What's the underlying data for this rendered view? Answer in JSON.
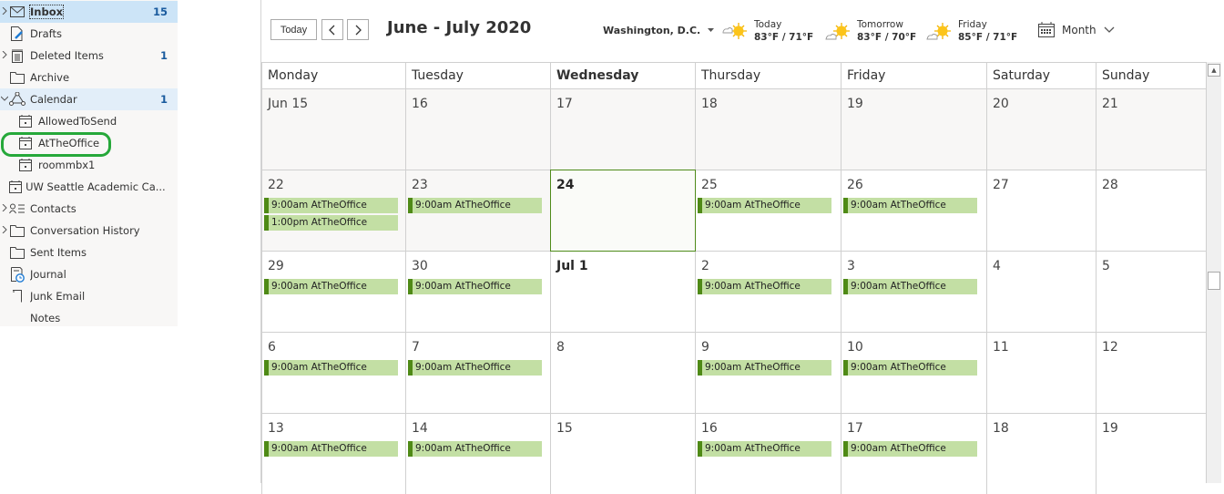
{
  "sidebar": {
    "folders": [
      {
        "label": "Inbox",
        "count": "15",
        "icon": "mail-icon",
        "expand": ">",
        "state": "selected"
      },
      {
        "label": "Drafts",
        "count": "",
        "icon": "drafts-icon",
        "expand": ""
      },
      {
        "label": "Deleted Items",
        "count": "1",
        "icon": "trash-icon",
        "expand": ">"
      },
      {
        "label": "Archive",
        "count": "",
        "icon": "folder-icon",
        "expand": ""
      },
      {
        "label": "Calendar",
        "count": "1",
        "icon": "calendar-group-icon",
        "expand": "v",
        "state": "highlight"
      },
      {
        "label": "AllowedToSend",
        "count": "",
        "icon": "calendar-icon",
        "sub": true
      },
      {
        "label": "AtTheOffice",
        "count": "",
        "icon": "calendar-icon",
        "sub": true,
        "circled": true
      },
      {
        "label": "roommbx1",
        "count": "",
        "icon": "calendar-icon",
        "sub": true
      },
      {
        "label": "UW Seattle Academic Ca...",
        "count": "",
        "icon": "calendar-icon",
        "sub": true
      },
      {
        "label": "Contacts",
        "count": "",
        "icon": "contacts-icon",
        "expand": ">"
      },
      {
        "label": "Conversation History",
        "count": "",
        "icon": "folder-icon",
        "expand": ">"
      },
      {
        "label": "Sent Items",
        "count": "",
        "icon": "folder-icon",
        "expand": ""
      },
      {
        "label": "Journal",
        "count": "",
        "icon": "journal-icon",
        "expand": ""
      },
      {
        "label": "Junk Email",
        "count": "",
        "icon": "junk-icon",
        "expand": ""
      },
      {
        "label": "Notes",
        "count": "",
        "icon": "",
        "expand": ""
      }
    ]
  },
  "toolbar": {
    "today_label": "Today",
    "prev_label": "<",
    "next_label": ">",
    "range_title": "June - July 2020",
    "location": "Washington, D.C.",
    "weather": [
      {
        "day": "Today",
        "temps": "83°F / 71°F"
      },
      {
        "day": "Tomorrow",
        "temps": "83°F / 70°F"
      },
      {
        "day": "Friday",
        "temps": "85°F / 71°F"
      }
    ],
    "view_label": "Month"
  },
  "calendar": {
    "colors": {
      "event_bg": "#c3dfa4",
      "event_bar": "#4f8a16",
      "today_border": "#4e8b1a"
    },
    "day_headers": [
      "Monday",
      "Tuesday",
      "Wednesday",
      "Thursday",
      "Friday",
      "Saturday",
      "Sunday"
    ],
    "current_weekday_index": 2,
    "weeks": [
      [
        {
          "label": "Jun 15",
          "past": true,
          "events": []
        },
        {
          "label": "16",
          "past": true,
          "events": []
        },
        {
          "label": "17",
          "past": true,
          "events": []
        },
        {
          "label": "18",
          "past": true,
          "events": []
        },
        {
          "label": "19",
          "past": true,
          "events": []
        },
        {
          "label": "20",
          "past": true,
          "events": []
        },
        {
          "label": "21",
          "past": true,
          "events": []
        }
      ],
      [
        {
          "label": "22",
          "past": true,
          "events": [
            "9:00am AtTheOffice",
            "1:00pm AtTheOffice"
          ]
        },
        {
          "label": "23",
          "past": true,
          "events": [
            "9:00am AtTheOffice"
          ]
        },
        {
          "label": "24",
          "today": true,
          "bold": true,
          "events": []
        },
        {
          "label": "25",
          "events": [
            "9:00am AtTheOffice"
          ]
        },
        {
          "label": "26",
          "events": [
            "9:00am AtTheOffice"
          ]
        },
        {
          "label": "27",
          "events": []
        },
        {
          "label": "28",
          "events": []
        }
      ],
      [
        {
          "label": "29",
          "events": [
            "9:00am AtTheOffice"
          ]
        },
        {
          "label": "30",
          "events": [
            "9:00am AtTheOffice"
          ]
        },
        {
          "label": "Jul 1",
          "bold": true,
          "events": []
        },
        {
          "label": "2",
          "events": [
            "9:00am AtTheOffice"
          ]
        },
        {
          "label": "3",
          "events": [
            "9:00am AtTheOffice"
          ]
        },
        {
          "label": "4",
          "events": []
        },
        {
          "label": "5",
          "events": []
        }
      ],
      [
        {
          "label": "6",
          "events": [
            "9:00am AtTheOffice"
          ]
        },
        {
          "label": "7",
          "events": [
            "9:00am AtTheOffice"
          ]
        },
        {
          "label": "8",
          "events": []
        },
        {
          "label": "9",
          "events": [
            "9:00am AtTheOffice"
          ]
        },
        {
          "label": "10",
          "events": [
            "9:00am AtTheOffice"
          ]
        },
        {
          "label": "11",
          "events": []
        },
        {
          "label": "12",
          "events": []
        }
      ],
      [
        {
          "label": "13",
          "events": [
            "9:00am AtTheOffice"
          ]
        },
        {
          "label": "14",
          "events": [
            "9:00am AtTheOffice"
          ]
        },
        {
          "label": "15",
          "events": []
        },
        {
          "label": "16",
          "events": [
            "9:00am AtTheOffice"
          ]
        },
        {
          "label": "17",
          "events": [
            "9:00am AtTheOffice"
          ]
        },
        {
          "label": "18",
          "events": []
        },
        {
          "label": "19",
          "events": []
        }
      ]
    ]
  }
}
